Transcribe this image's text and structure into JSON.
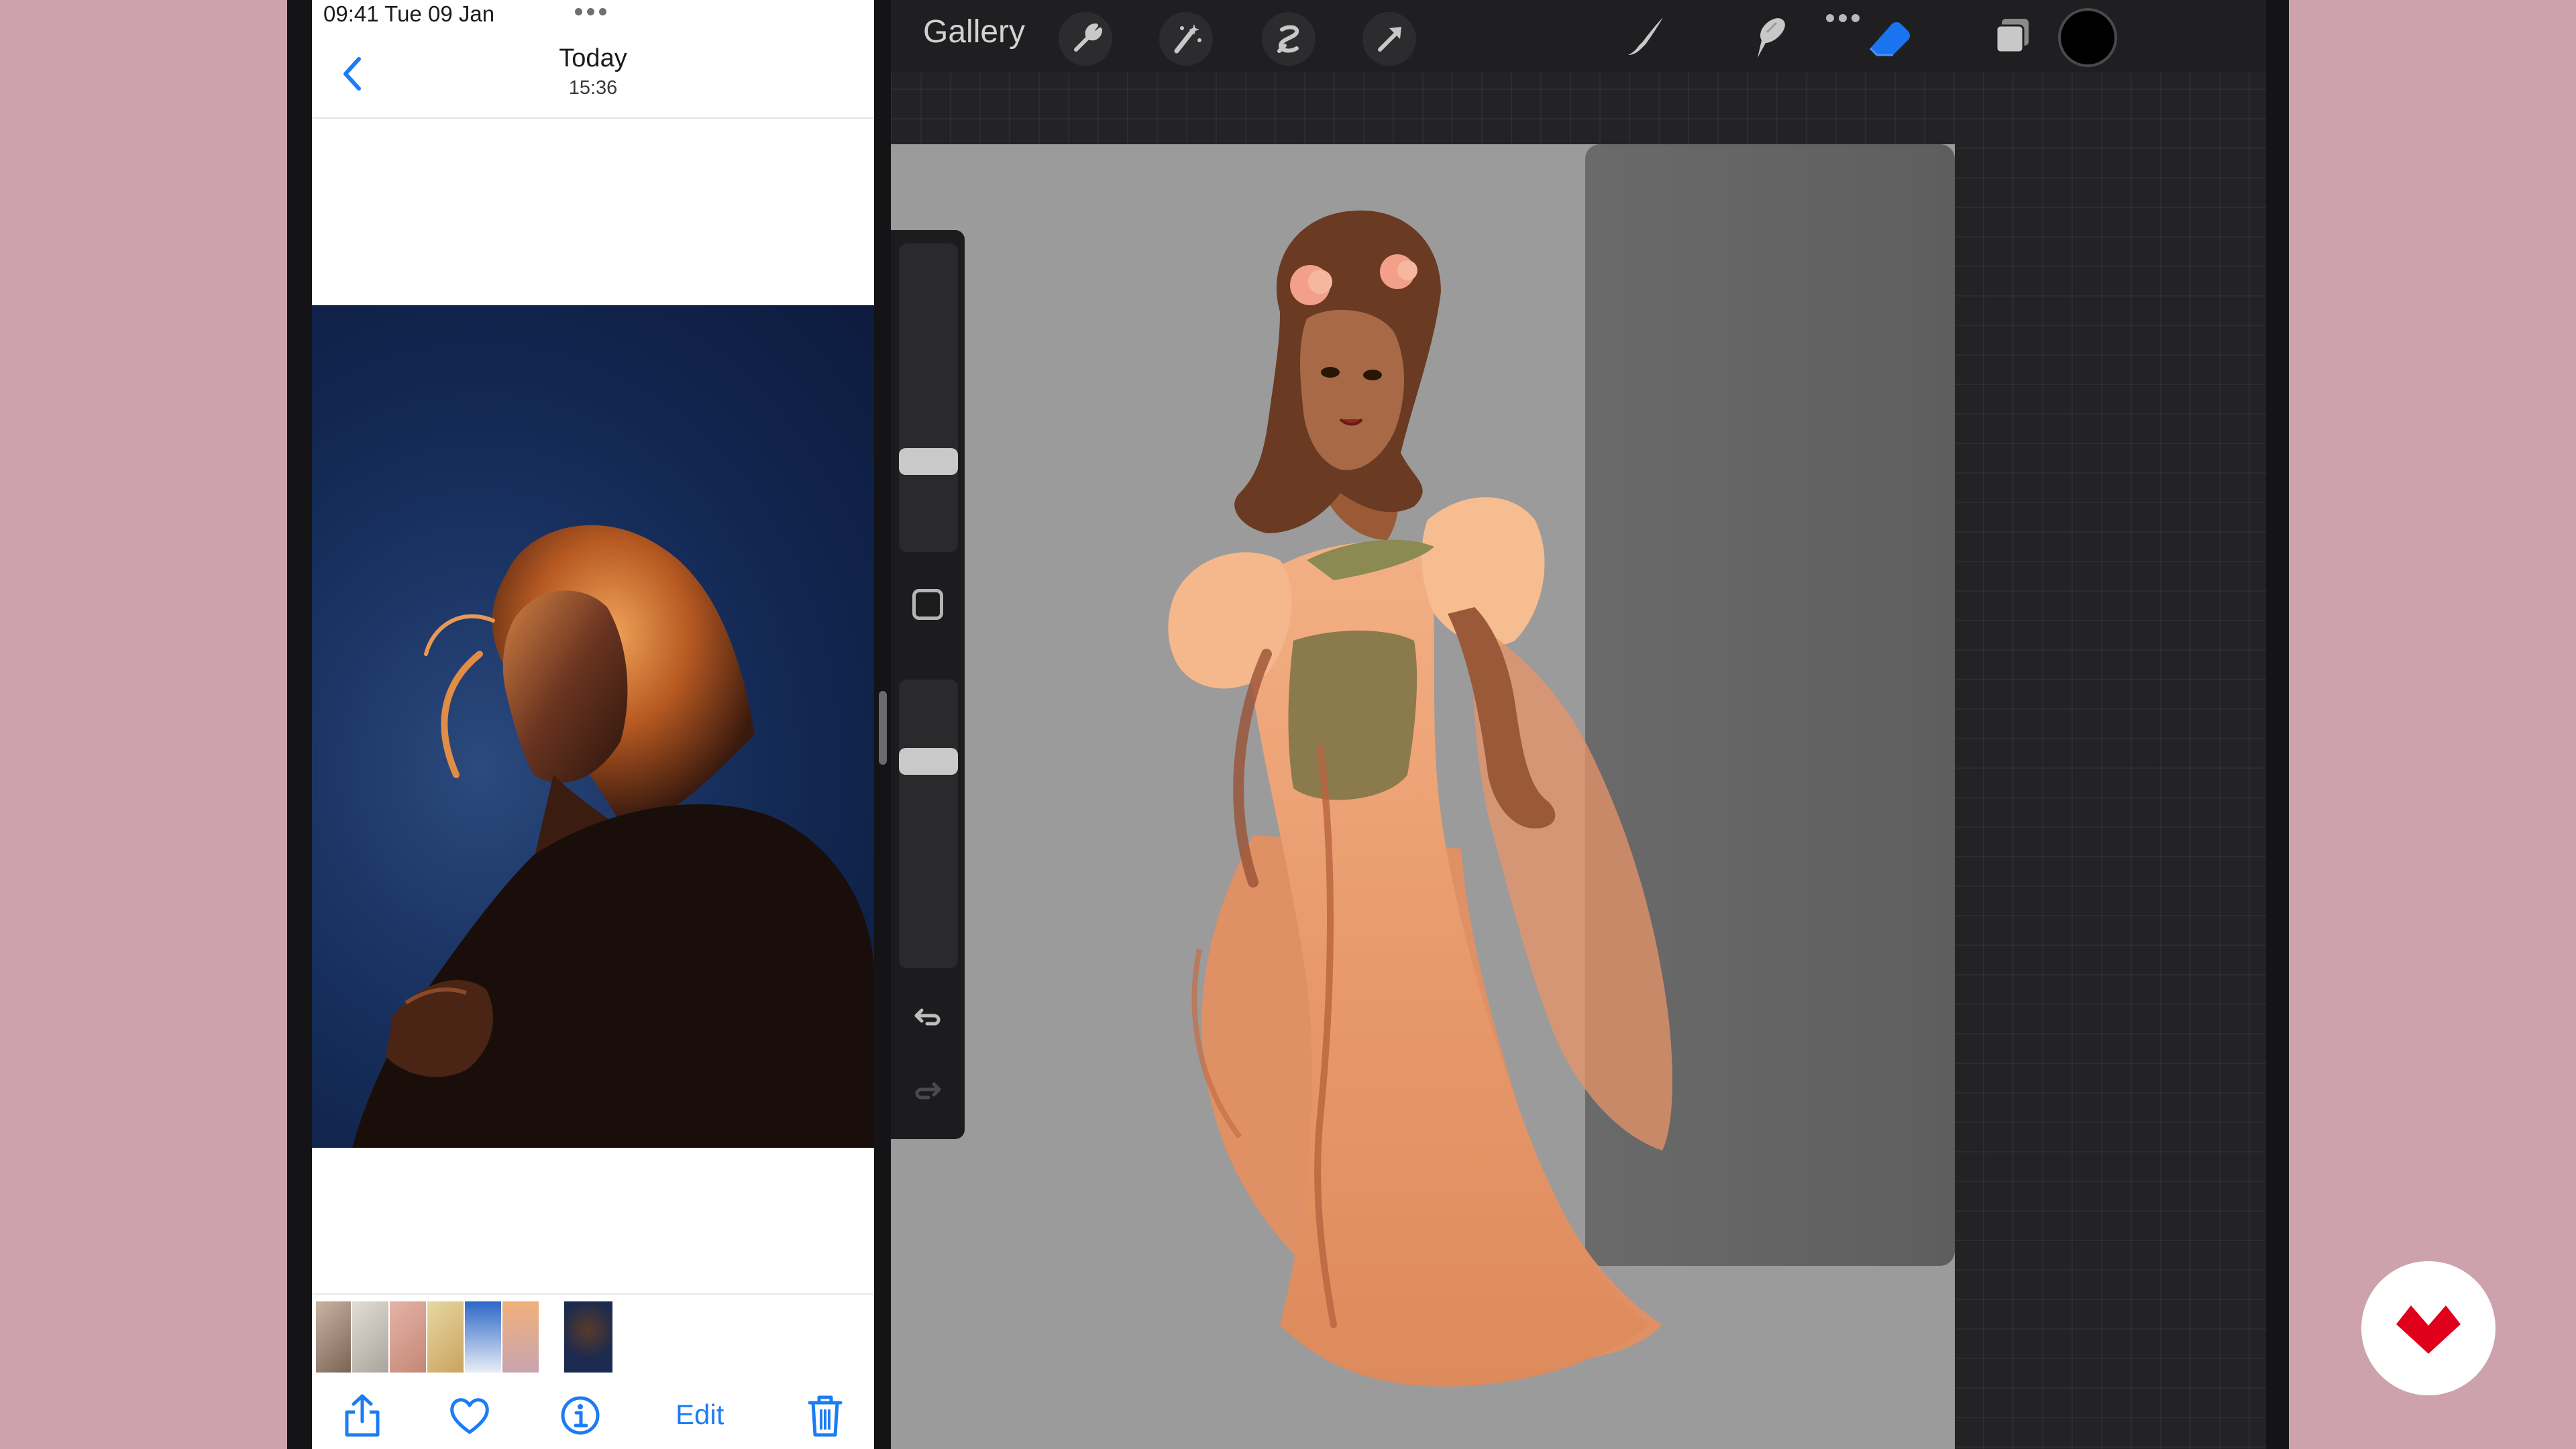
{
  "status_bar": {
    "time_date": "09:41   Tue 09 Jan"
  },
  "photos": {
    "title": "Today",
    "subtitle": "15:36",
    "edit_label": "Edit",
    "accent_color": "#1c7cf4",
    "toolbar_icons": [
      "share-icon",
      "heart-icon",
      "info-icon",
      "trash-icon"
    ],
    "thumbnails": [
      "thumb-1",
      "thumb-2",
      "thumb-3",
      "thumb-4",
      "thumb-5",
      "thumb-6",
      "thumb-selected"
    ]
  },
  "procreate": {
    "gallery_label": "Gallery",
    "tools_left": [
      "wrench-icon",
      "magic-wand-icon",
      "selection-icon",
      "transform-arrow-icon"
    ],
    "tools_right": [
      "brush-icon",
      "smudge-icon",
      "eraser-icon",
      "layers-icon"
    ],
    "active_tool": "eraser",
    "active_color": "#000000",
    "highlight_color": "#1a74f0"
  },
  "brand": {
    "name": "Domestika",
    "color": "#e0001b"
  }
}
